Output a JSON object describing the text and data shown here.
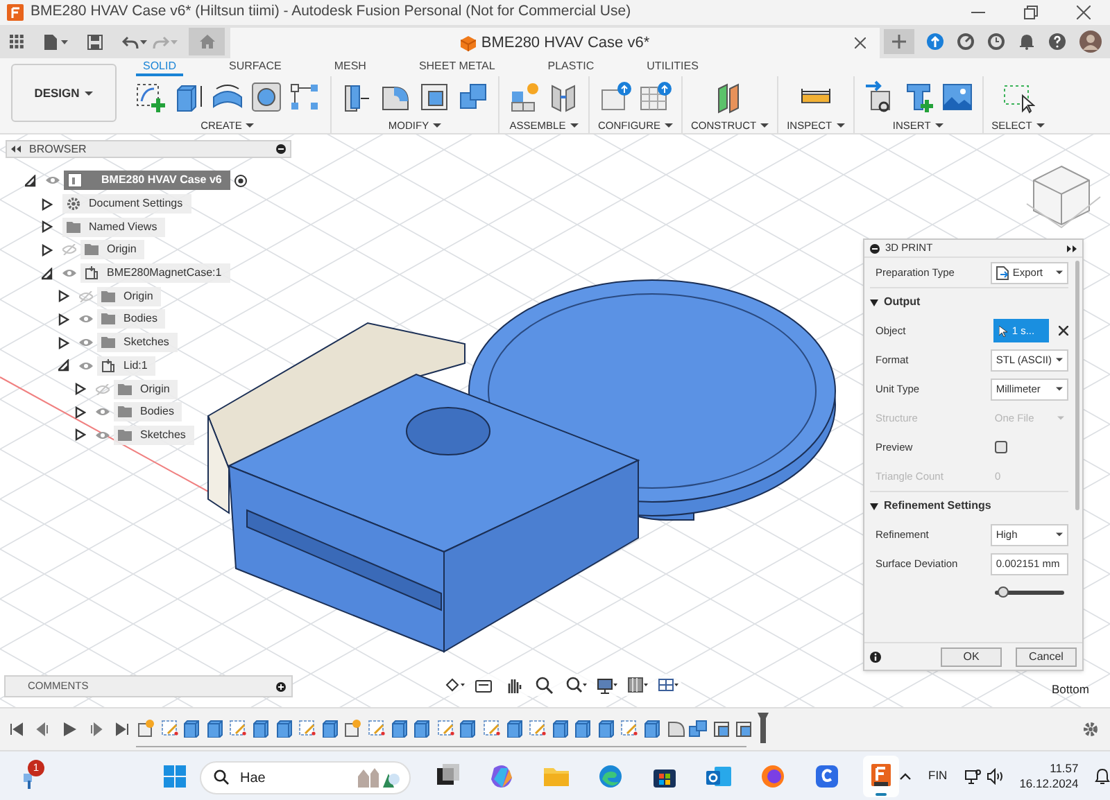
{
  "window": {
    "title": "BME280 HVAV Case v6* (Hiltsun tiimi) - Autodesk Fusion Personal (Not for Commercial Use)"
  },
  "document_tab": {
    "title": "BME280 HVAV Case v6*"
  },
  "workspace": {
    "label": "DESIGN"
  },
  "ribbon_tabs": [
    {
      "label": "SOLID",
      "selected": true
    },
    {
      "label": "SURFACE",
      "selected": false
    },
    {
      "label": "MESH",
      "selected": false
    },
    {
      "label": "SHEET METAL",
      "selected": false
    },
    {
      "label": "PLASTIC",
      "selected": false
    },
    {
      "label": "UTILITIES",
      "selected": false
    }
  ],
  "tool_groups": [
    {
      "label": "CREATE",
      "tools": [
        {
          "kind": "sketch"
        },
        {
          "kind": "extrude"
        },
        {
          "kind": "revolve"
        },
        {
          "kind": "hole"
        },
        {
          "kind": "pattern"
        }
      ]
    },
    {
      "label": "MODIFY",
      "tools": [
        {
          "kind": "press-pull"
        },
        {
          "kind": "fillet"
        },
        {
          "kind": "shell"
        },
        {
          "kind": "combine"
        }
      ]
    },
    {
      "label": "ASSEMBLE",
      "tools": [
        {
          "kind": "new-component"
        },
        {
          "kind": "joint"
        }
      ]
    },
    {
      "label": "CONFIGURE",
      "tools": [
        {
          "kind": "configure"
        },
        {
          "kind": "table"
        }
      ]
    },
    {
      "label": "CONSTRUCT",
      "tools": [
        {
          "kind": "plane"
        }
      ]
    },
    {
      "label": "INSPECT",
      "tools": [
        {
          "kind": "measure"
        }
      ]
    },
    {
      "label": "INSERT",
      "tools": [
        {
          "kind": "insert-link"
        },
        {
          "kind": "decal"
        },
        {
          "kind": "canvas"
        }
      ]
    },
    {
      "label": "SELECT",
      "tools": [
        {
          "kind": "select"
        }
      ]
    }
  ],
  "browser": {
    "title": "BROWSER",
    "tree": [
      {
        "kind": "document",
        "label": "BME280 HVAV Case v6",
        "expanded": true,
        "children": [
          {
            "kind": "settings",
            "label": "Document Settings",
            "expanded": false
          },
          {
            "kind": "folder",
            "label": "Named Views",
            "expanded": false
          },
          {
            "kind": "folder",
            "label": "Origin",
            "expanded": false,
            "visible": false
          },
          {
            "kind": "component",
            "label": "BME280MagnetCase:1",
            "expanded": true,
            "visible": true,
            "children": [
              {
                "kind": "folder",
                "label": "Origin",
                "expanded": false,
                "visible": false
              },
              {
                "kind": "folder",
                "label": "Bodies",
                "expanded": false,
                "visible": true
              },
              {
                "kind": "folder",
                "label": "Sketches",
                "expanded": false,
                "visible": true
              },
              {
                "kind": "component",
                "label": "Lid:1",
                "expanded": true,
                "visible": true,
                "children": [
                  {
                    "kind": "folder",
                    "label": "Origin",
                    "expanded": false,
                    "visible": false
                  },
                  {
                    "kind": "folder",
                    "label": "Bodies",
                    "expanded": false,
                    "visible": true
                  },
                  {
                    "kind": "folder",
                    "label": "Sketches",
                    "expanded": false,
                    "visible": true
                  }
                ]
              }
            ]
          }
        ]
      }
    ]
  },
  "print_panel": {
    "title": "3D PRINT",
    "rows": [
      {
        "kind": "icon-dropdown",
        "label": "Preparation Type",
        "value": "Export",
        "disabled": false
      },
      {
        "kind": "section",
        "label": "Output",
        "expanded": true
      },
      {
        "kind": "selection",
        "label": "Object",
        "value": "1 s...",
        "disabled": false
      },
      {
        "kind": "dropdown",
        "label": "Format",
        "value": "STL (ASCII)",
        "disabled": false
      },
      {
        "kind": "dropdown",
        "label": "Unit Type",
        "value": "Millimeter",
        "disabled": false
      },
      {
        "kind": "dropdown",
        "label": "Structure",
        "value": "One File",
        "disabled": true
      },
      {
        "kind": "checkbox",
        "label": "Preview",
        "checked": false,
        "disabled": false
      },
      {
        "kind": "readout",
        "label": "Triangle Count",
        "value": "0",
        "disabled": true
      },
      {
        "kind": "section",
        "label": "Refinement Settings",
        "expanded": true
      },
      {
        "kind": "dropdown",
        "label": "Refinement",
        "value": "High",
        "disabled": false
      },
      {
        "kind": "input",
        "label": "Surface Deviation",
        "value": "0.002151 mm",
        "disabled": false
      },
      {
        "kind": "slider",
        "level": 0.05,
        "disabled": false
      }
    ],
    "buttons": [
      "OK",
      "Cancel"
    ]
  },
  "comments": {
    "title": "COMMENTS"
  },
  "view_label": "Bottom",
  "timeline": {
    "features": [
      {
        "kind": "component"
      },
      {
        "kind": "sketch"
      },
      {
        "kind": "extrude"
      },
      {
        "kind": "extrude"
      },
      {
        "kind": "sketch"
      },
      {
        "kind": "extrude"
      },
      {
        "kind": "extrude"
      },
      {
        "kind": "sketch"
      },
      {
        "kind": "extrude"
      },
      {
        "kind": "component"
      },
      {
        "kind": "sketch"
      },
      {
        "kind": "extrude"
      },
      {
        "kind": "extrude"
      },
      {
        "kind": "sketch"
      },
      {
        "kind": "extrude"
      },
      {
        "kind": "sketch"
      },
      {
        "kind": "extrude"
      },
      {
        "kind": "sketch"
      },
      {
        "kind": "extrude"
      },
      {
        "kind": "extrude"
      },
      {
        "kind": "extrude"
      },
      {
        "kind": "sketch"
      },
      {
        "kind": "extrude"
      },
      {
        "kind": "fillet"
      },
      {
        "kind": "combine"
      },
      {
        "kind": "shell"
      },
      {
        "kind": "shell"
      }
    ]
  },
  "taskbar": {
    "notification_badge": "1",
    "search": {
      "placeholder": "Hae"
    },
    "apps": [
      {
        "kind": "task-view",
        "active": false
      },
      {
        "kind": "copilot",
        "active": false
      },
      {
        "kind": "explorer",
        "active": false
      },
      {
        "kind": "edge",
        "active": false
      },
      {
        "kind": "store",
        "active": false
      },
      {
        "kind": "outlook",
        "active": false
      },
      {
        "kind": "firefox",
        "active": false
      },
      {
        "kind": "c-app",
        "active": false
      },
      {
        "kind": "fusion",
        "active": true
      }
    ],
    "language": "FIN",
    "time": "11.57",
    "date": "16.12.2024"
  }
}
